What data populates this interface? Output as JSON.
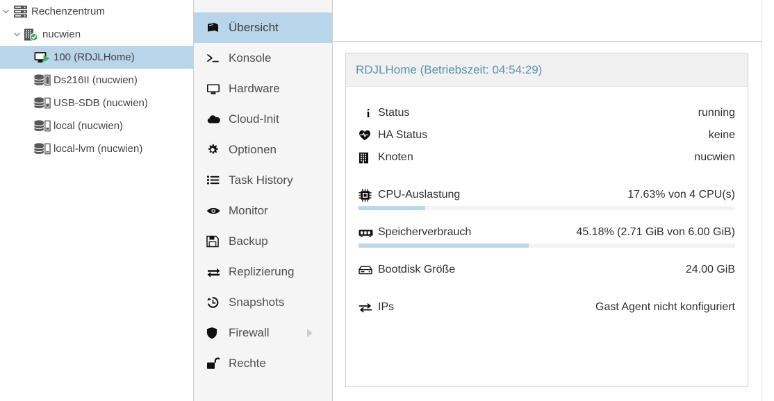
{
  "tree": {
    "items": [
      {
        "label": "Rechenzentrum",
        "icon": "datacenter-icon",
        "depth": 0,
        "expander": "expanded",
        "selected": false
      },
      {
        "label": "nucwien",
        "icon": "node-online-icon",
        "depth": 1,
        "expander": "expanded",
        "selected": false
      },
      {
        "label": "100 (RDJLHome)",
        "icon": "qemu-vm-running-icon",
        "depth": 2,
        "expander": "none",
        "selected": true
      },
      {
        "label": "Ds216II (nucwien)",
        "icon": "storage-icon",
        "depth": 2,
        "expander": "none",
        "selected": false
      },
      {
        "label": "USB-SDB (nucwien)",
        "icon": "storage-icon",
        "depth": 2,
        "expander": "none",
        "selected": false
      },
      {
        "label": "local (nucwien)",
        "icon": "storage-icon",
        "depth": 2,
        "expander": "none",
        "selected": false
      },
      {
        "label": "local-lvm (nucwien)",
        "icon": "storage-icon",
        "depth": 2,
        "expander": "none",
        "selected": false
      }
    ]
  },
  "menu": {
    "items": [
      {
        "label": "Übersicht",
        "icon": "book-icon",
        "selected": true,
        "submenu": false
      },
      {
        "label": "Konsole",
        "icon": "terminal-icon",
        "selected": false,
        "submenu": false
      },
      {
        "label": "Hardware",
        "icon": "monitor-icon",
        "selected": false,
        "submenu": false
      },
      {
        "label": "Cloud-Init",
        "icon": "cloud-icon",
        "selected": false,
        "submenu": false
      },
      {
        "label": "Optionen",
        "icon": "gear-icon",
        "selected": false,
        "submenu": false
      },
      {
        "label": "Task History",
        "icon": "list-icon",
        "selected": false,
        "submenu": false
      },
      {
        "label": "Monitor",
        "icon": "eye-icon",
        "selected": false,
        "submenu": false
      },
      {
        "label": "Backup",
        "icon": "floppy-disk-icon",
        "selected": false,
        "submenu": false
      },
      {
        "label": "Replizierung",
        "icon": "exchange-icon",
        "selected": false,
        "submenu": false
      },
      {
        "label": "Snapshots",
        "icon": "history-icon",
        "selected": false,
        "submenu": false
      },
      {
        "label": "Firewall",
        "icon": "shield-icon",
        "selected": false,
        "submenu": true
      },
      {
        "label": "Rechte",
        "icon": "unlock-icon",
        "selected": false,
        "submenu": false
      }
    ]
  },
  "panel": {
    "title": "RDJLHome (Betriebszeit: 04:54:29)",
    "rows": [
      {
        "icon": "info-icon",
        "label": "Status",
        "value": "running"
      },
      {
        "icon": "heartbeat-icon",
        "label": "HA Status",
        "value": "keine"
      },
      {
        "icon": "node-icon",
        "label": "Knoten",
        "value": "nucwien"
      }
    ],
    "metrics": [
      {
        "icon": "cpu-icon",
        "label": "CPU-Auslastung",
        "value": "17.63% von 4 CPU(s)",
        "percent": 17.63
      },
      {
        "icon": "memory-icon",
        "label": "Speicherverbrauch",
        "value": "45.18% (2.71 GiB von 6.00 GiB)",
        "percent": 45.18
      }
    ],
    "bootdisk": {
      "icon": "hdd-icon",
      "label": "Bootdisk Größe",
      "value": "24.00 GiB"
    },
    "ips": {
      "icon": "exchange-icon",
      "label": "IPs",
      "value": "Gast Agent nicht konfiguriert"
    }
  },
  "colors": {
    "selection": "#b9d5e9",
    "title": "#5b93ad",
    "bar_fill": "#bcd8ec",
    "bar_track": "#f3f3f3",
    "menu_bg": "#f5f5f5"
  }
}
